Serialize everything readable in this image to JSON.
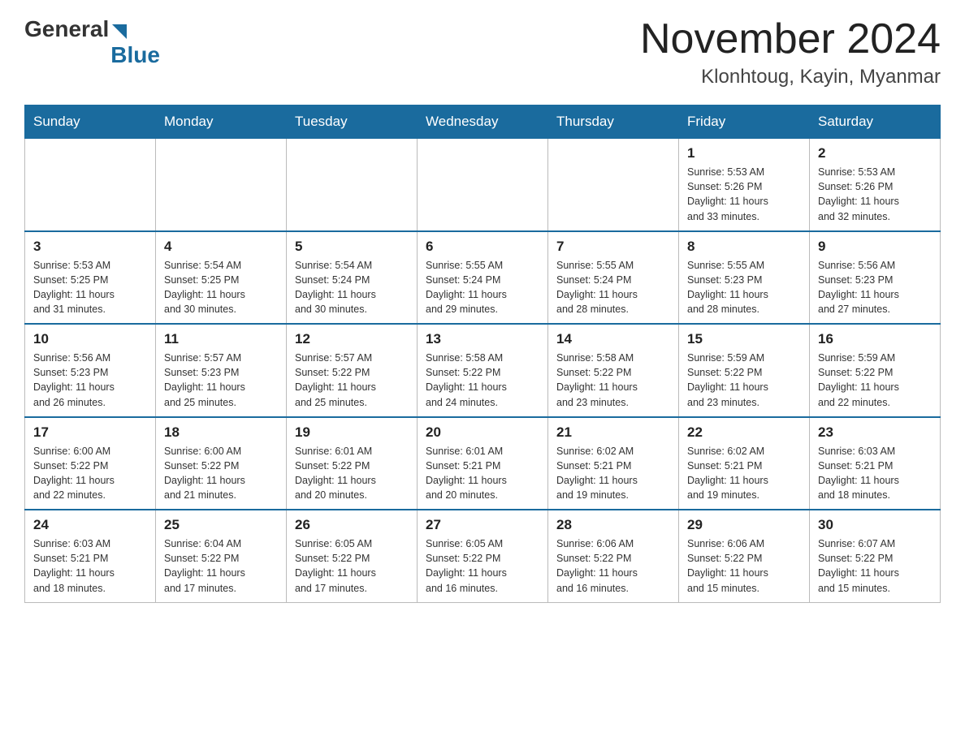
{
  "header": {
    "logo": {
      "general": "General",
      "blue": "Blue"
    },
    "title": "November 2024",
    "location": "Klonhtoug, Kayin, Myanmar"
  },
  "calendar": {
    "weekdays": [
      "Sunday",
      "Monday",
      "Tuesday",
      "Wednesday",
      "Thursday",
      "Friday",
      "Saturday"
    ],
    "weeks": [
      [
        {
          "day": "",
          "info": ""
        },
        {
          "day": "",
          "info": ""
        },
        {
          "day": "",
          "info": ""
        },
        {
          "day": "",
          "info": ""
        },
        {
          "day": "",
          "info": ""
        },
        {
          "day": "1",
          "info": "Sunrise: 5:53 AM\nSunset: 5:26 PM\nDaylight: 11 hours\nand 33 minutes."
        },
        {
          "day": "2",
          "info": "Sunrise: 5:53 AM\nSunset: 5:26 PM\nDaylight: 11 hours\nand 32 minutes."
        }
      ],
      [
        {
          "day": "3",
          "info": "Sunrise: 5:53 AM\nSunset: 5:25 PM\nDaylight: 11 hours\nand 31 minutes."
        },
        {
          "day": "4",
          "info": "Sunrise: 5:54 AM\nSunset: 5:25 PM\nDaylight: 11 hours\nand 30 minutes."
        },
        {
          "day": "5",
          "info": "Sunrise: 5:54 AM\nSunset: 5:24 PM\nDaylight: 11 hours\nand 30 minutes."
        },
        {
          "day": "6",
          "info": "Sunrise: 5:55 AM\nSunset: 5:24 PM\nDaylight: 11 hours\nand 29 minutes."
        },
        {
          "day": "7",
          "info": "Sunrise: 5:55 AM\nSunset: 5:24 PM\nDaylight: 11 hours\nand 28 minutes."
        },
        {
          "day": "8",
          "info": "Sunrise: 5:55 AM\nSunset: 5:23 PM\nDaylight: 11 hours\nand 28 minutes."
        },
        {
          "day": "9",
          "info": "Sunrise: 5:56 AM\nSunset: 5:23 PM\nDaylight: 11 hours\nand 27 minutes."
        }
      ],
      [
        {
          "day": "10",
          "info": "Sunrise: 5:56 AM\nSunset: 5:23 PM\nDaylight: 11 hours\nand 26 minutes."
        },
        {
          "day": "11",
          "info": "Sunrise: 5:57 AM\nSunset: 5:23 PM\nDaylight: 11 hours\nand 25 minutes."
        },
        {
          "day": "12",
          "info": "Sunrise: 5:57 AM\nSunset: 5:22 PM\nDaylight: 11 hours\nand 25 minutes."
        },
        {
          "day": "13",
          "info": "Sunrise: 5:58 AM\nSunset: 5:22 PM\nDaylight: 11 hours\nand 24 minutes."
        },
        {
          "day": "14",
          "info": "Sunrise: 5:58 AM\nSunset: 5:22 PM\nDaylight: 11 hours\nand 23 minutes."
        },
        {
          "day": "15",
          "info": "Sunrise: 5:59 AM\nSunset: 5:22 PM\nDaylight: 11 hours\nand 23 minutes."
        },
        {
          "day": "16",
          "info": "Sunrise: 5:59 AM\nSunset: 5:22 PM\nDaylight: 11 hours\nand 22 minutes."
        }
      ],
      [
        {
          "day": "17",
          "info": "Sunrise: 6:00 AM\nSunset: 5:22 PM\nDaylight: 11 hours\nand 22 minutes."
        },
        {
          "day": "18",
          "info": "Sunrise: 6:00 AM\nSunset: 5:22 PM\nDaylight: 11 hours\nand 21 minutes."
        },
        {
          "day": "19",
          "info": "Sunrise: 6:01 AM\nSunset: 5:22 PM\nDaylight: 11 hours\nand 20 minutes."
        },
        {
          "day": "20",
          "info": "Sunrise: 6:01 AM\nSunset: 5:21 PM\nDaylight: 11 hours\nand 20 minutes."
        },
        {
          "day": "21",
          "info": "Sunrise: 6:02 AM\nSunset: 5:21 PM\nDaylight: 11 hours\nand 19 minutes."
        },
        {
          "day": "22",
          "info": "Sunrise: 6:02 AM\nSunset: 5:21 PM\nDaylight: 11 hours\nand 19 minutes."
        },
        {
          "day": "23",
          "info": "Sunrise: 6:03 AM\nSunset: 5:21 PM\nDaylight: 11 hours\nand 18 minutes."
        }
      ],
      [
        {
          "day": "24",
          "info": "Sunrise: 6:03 AM\nSunset: 5:21 PM\nDaylight: 11 hours\nand 18 minutes."
        },
        {
          "day": "25",
          "info": "Sunrise: 6:04 AM\nSunset: 5:22 PM\nDaylight: 11 hours\nand 17 minutes."
        },
        {
          "day": "26",
          "info": "Sunrise: 6:05 AM\nSunset: 5:22 PM\nDaylight: 11 hours\nand 17 minutes."
        },
        {
          "day": "27",
          "info": "Sunrise: 6:05 AM\nSunset: 5:22 PM\nDaylight: 11 hours\nand 16 minutes."
        },
        {
          "day": "28",
          "info": "Sunrise: 6:06 AM\nSunset: 5:22 PM\nDaylight: 11 hours\nand 16 minutes."
        },
        {
          "day": "29",
          "info": "Sunrise: 6:06 AM\nSunset: 5:22 PM\nDaylight: 11 hours\nand 15 minutes."
        },
        {
          "day": "30",
          "info": "Sunrise: 6:07 AM\nSunset: 5:22 PM\nDaylight: 11 hours\nand 15 minutes."
        }
      ]
    ]
  }
}
